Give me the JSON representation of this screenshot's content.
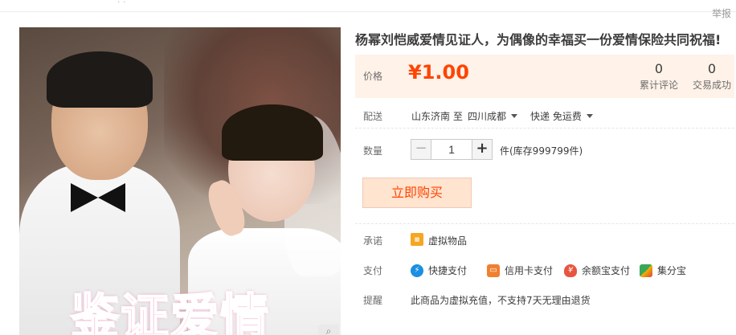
{
  "header": {
    "report_label": "举报"
  },
  "product": {
    "title": "杨幂刘恺威爱情见证人，为偶像的幸福买一份爱情保险共同祝福!",
    "image_caption": "鉴证爱情"
  },
  "price": {
    "label": "价格",
    "value": "¥1.00",
    "reviews_count": "0",
    "reviews_label": "累计评论",
    "deals_count": "0",
    "deals_label": "交易成功"
  },
  "shipping": {
    "label": "配送",
    "from": "山东济南 至",
    "to": "四川成都",
    "method": "快递 免运费"
  },
  "quantity": {
    "label": "数量",
    "value": "1",
    "minus": "−",
    "plus": "+",
    "stock_text": "件(库存999799件)"
  },
  "buy_button": {
    "label": "立即购买"
  },
  "promise": {
    "label": "承诺",
    "item": "虚拟物品"
  },
  "payment": {
    "label": "支付",
    "methods": [
      "快捷支付",
      "信用卡支付",
      "余额宝支付",
      "集分宝"
    ]
  },
  "notice": {
    "label": "提醒",
    "text": "此商品为虚拟充值，不支持7天无理由退货"
  },
  "icons": {
    "zoom": "magnifier-icon",
    "promise": "virtual-goods-icon",
    "quick_pay": "lightning-icon",
    "credit": "credit-card-icon",
    "yeb": "money-bag-icon",
    "jfb": "jifenbao-icon"
  },
  "colors": {
    "accent": "#ff4400",
    "price_bg": "#fff2e8",
    "buy_bg": "#ffe4d0"
  }
}
